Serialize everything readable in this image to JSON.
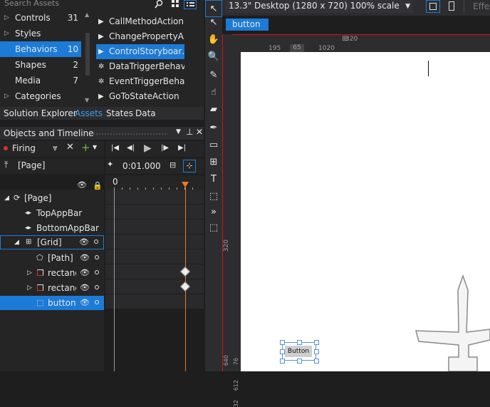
{
  "assets": {
    "search_placeholder": "Search Assets",
    "categories": [
      {
        "label": "Controls",
        "count": "31",
        "expanded": false
      },
      {
        "label": "Styles",
        "count": "",
        "expanded": false
      },
      {
        "label": "Behaviors",
        "count": "10",
        "selected": true
      },
      {
        "label": "Shapes",
        "count": "2"
      },
      {
        "label": "Media",
        "count": "7"
      },
      {
        "label": "Categories",
        "count": "",
        "expanded": false
      }
    ],
    "items": [
      {
        "label": "CallMethodAction",
        "icon": "action-icon"
      },
      {
        "label": "ChangePropertyA…",
        "icon": "action-icon"
      },
      {
        "label": "ControlStoryboar…",
        "icon": "action-icon",
        "selected": true
      },
      {
        "label": "DataTriggerBehav…",
        "icon": "behavior-icon"
      },
      {
        "label": "EventTriggerBeha…",
        "icon": "behavior-icon"
      },
      {
        "label": "GoToStateAction",
        "icon": "action-icon"
      }
    ]
  },
  "tabs_top": [
    {
      "label": "Solution Explorer",
      "active": false
    },
    {
      "label": "Assets",
      "active": true
    },
    {
      "label": "States",
      "active": false
    },
    {
      "label": "Data",
      "active": false
    }
  ],
  "objects": {
    "title": "Objects and Timeline",
    "storyboard": "Firing",
    "scope": "[Page]",
    "time": "0:01.000",
    "ruler_zero": "0",
    "tree": [
      {
        "label": "[Page]",
        "indent": 0,
        "icon": "page-icon"
      },
      {
        "label": "TopAppBar",
        "indent": 2,
        "icon": "appbar-icon"
      },
      {
        "label": "BottomAppBar",
        "indent": 2,
        "icon": "appbar-icon"
      },
      {
        "label": "[Grid]",
        "indent": 1,
        "icon": "grid-icon",
        "grid": true
      },
      {
        "label": "[Path]",
        "indent": 3,
        "icon": "path-icon"
      },
      {
        "label": "rectang",
        "indent": 2,
        "icon": "rectangle-icon",
        "kf": true
      },
      {
        "label": "rectang",
        "indent": 2,
        "icon": "rectangle-icon",
        "kf": true
      },
      {
        "label": "button",
        "indent": 3,
        "icon": "button-icon",
        "selected": true
      }
    ]
  },
  "design": {
    "device": "13.3\" Desktop (1280 x 720) 100% scale",
    "effects_label": "Effe",
    "element_badge": "button",
    "button_text": "Button",
    "ruler_labels": {
      "top_320": "320",
      "top_195": "195",
      "top_65": "65",
      "top_1020": "1020",
      "left_320": "320",
      "left_612": "612",
      "left_32": "32",
      "left_640": "640",
      "left_76": "76"
    }
  }
}
